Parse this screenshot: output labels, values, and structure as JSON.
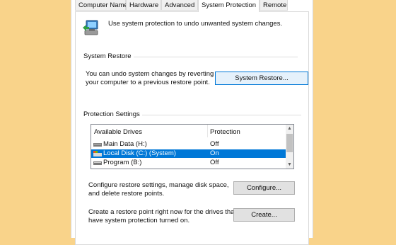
{
  "tabs": [
    {
      "label": "Computer Name",
      "active": false
    },
    {
      "label": "Hardware",
      "active": false
    },
    {
      "label": "Advanced",
      "active": false
    },
    {
      "label": "System Protection",
      "active": true
    },
    {
      "label": "Remote",
      "active": false
    }
  ],
  "intro": {
    "icon": "system-protection-icon",
    "text": "Use system protection to undo unwanted system changes."
  },
  "system_restore": {
    "group_label": "System Restore",
    "description_line1": "You can undo system changes by reverting",
    "description_line2": "your computer to a previous restore point.",
    "button_label": "System Restore..."
  },
  "protection_settings": {
    "group_label": "Protection Settings",
    "columns": {
      "drives": "Available Drives",
      "protection": "Protection"
    },
    "drives": [
      {
        "name": "Main Data (H:)",
        "protection": "Off",
        "icon": "drive-icon",
        "selected": false
      },
      {
        "name": "Local Disk (C:) (System)",
        "protection": "On",
        "icon": "system-drive-icon",
        "selected": true
      },
      {
        "name": "Program (B:)",
        "protection": "Off",
        "icon": "drive-icon",
        "selected": false
      }
    ],
    "configure_line1": "Configure restore settings, manage disk space,",
    "configure_line2": "and delete restore points.",
    "configure_button": "Configure...",
    "create_line1": "Create a restore point right now for the drives that",
    "create_line2": "have system protection turned on.",
    "create_button": "Create..."
  },
  "colors": {
    "background": "#f9d38a",
    "selection": "#0078d7",
    "focus_border": "#0078d7"
  }
}
